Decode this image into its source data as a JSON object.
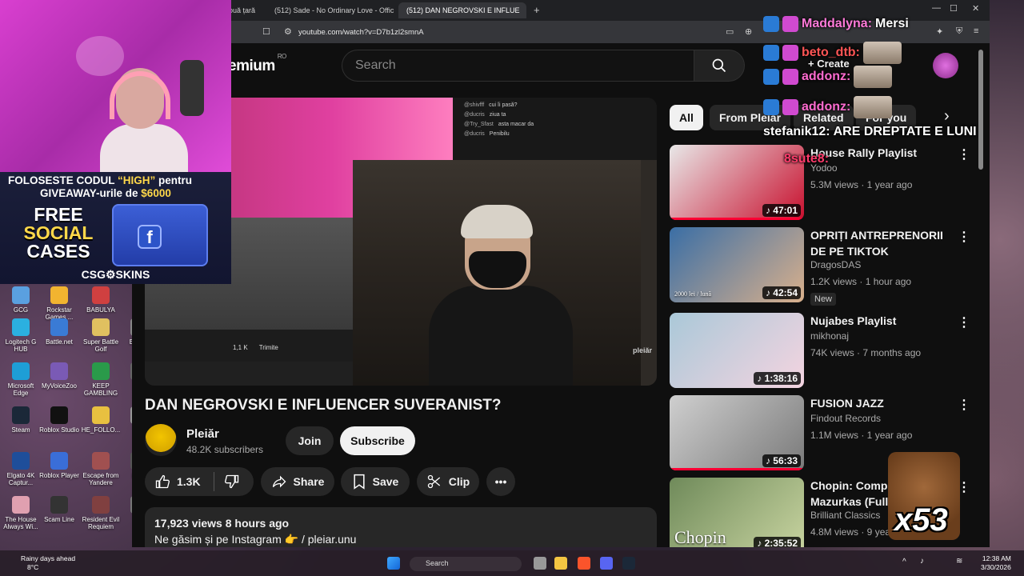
{
  "browser": {
    "tabs": [
      {
        "label": "ouă țară"
      },
      {
        "label": "(512) Sade - No Ordinary Love - Offic"
      },
      {
        "label": "(512) DAN NEGROVSKI E INFLUE"
      }
    ],
    "url": "youtube.com/watch?v=D7b1zl2smnA"
  },
  "youtube": {
    "logo_text": "emium",
    "logo_region": "RO",
    "search_placeholder": "Search",
    "create_label": "Create",
    "video_chat": [
      {
        "user": "@shivfff",
        "msg": "cui îi pasă?"
      },
      {
        "user": "@ducris",
        "msg": "ziua ta"
      },
      {
        "user": "@Try_Sfast",
        "msg": "asta macar da"
      },
      {
        "user": "@ducris",
        "msg": "Penibilu"
      }
    ],
    "video_likes_small": "1,1 K",
    "video_share_small": "Trimite",
    "video_watermark": "pleiăr",
    "video_title": "DAN NEGROVSKI E INFLUENCER SUVERANIST?",
    "channel_name": "Pleiăr",
    "channel_subs": "48.2K subscribers",
    "join_label": "Join",
    "subscribe_label": "Subscribe",
    "like_count": "1.3K",
    "share_label": "Share",
    "save_label": "Save",
    "clip_label": "Clip",
    "desc_meta": "17,923 views  8 hours ago",
    "desc_text": "Ne găsim și pe Instagram 👉  / pleiar.unu",
    "chips": [
      "All",
      "From Pleiăr",
      "Related",
      "For you"
    ],
    "recommendations": [
      {
        "title": "House Rally Playlist",
        "channel": "Yodoo",
        "meta": "5.3M views · 1 year ago",
        "duration": "47:01",
        "colors": [
          "#e8e8e8",
          "#c8102e"
        ]
      },
      {
        "title": "OPRIȚI ANTREPRENORII DE PE TIKTOK",
        "channel": "DragosDAS",
        "meta": "1.2K views · 1 hour ago",
        "duration": "42:54",
        "badge": "New",
        "thumb_text": "2000 lei / lună",
        "colors": [
          "#3a6ea5",
          "#d9b08c"
        ]
      },
      {
        "title": "Nujabes Playlist",
        "channel": "mikhonaj",
        "meta": "74K views · 7 months ago",
        "duration": "1:38:16",
        "colors": [
          "#aac8d8",
          "#f4d4e0"
        ]
      },
      {
        "title": "FUSION JAZZ",
        "channel": "Findout Records",
        "meta": "1.1M views · 1 year ago",
        "duration": "56:33",
        "colors": [
          "#cfcfcf",
          "#7a7a7a"
        ]
      },
      {
        "title": "Chopin: Complete Mazurkas (Full Album)",
        "channel": "Brilliant Classics",
        "meta": "4.8M views · 9 years ago",
        "duration": "2:35:52",
        "thumb_text": "Chopin",
        "colors": [
          "#6f8a5a",
          "#c8d4a0"
        ]
      }
    ]
  },
  "stream": {
    "promo_line1_a": "FOLOSESTE CODUL ",
    "promo_line1_code": "“HIGH”",
    "promo_line1_b": " pentru",
    "promo_line2_a": "GIVEAWAY-urile de ",
    "promo_line2_amount": "$6000",
    "promo_free": "FREE",
    "promo_social": "SOCIAL",
    "promo_cases": "CASES",
    "promo_brand": "CSG⚙SKINS",
    "chat": [
      {
        "user": "Maddalyna:",
        "msg": "Mersi",
        "color": "#ff7ad9"
      },
      {
        "user": "beto_dtb:",
        "msg": "",
        "color": "#ff5555"
      },
      {
        "user": "addonz:",
        "msg": "",
        "color": "#ff6bd0"
      },
      {
        "user": "addonz:",
        "msg": "",
        "color": "#ff6bd0"
      },
      {
        "user": "stefanik12:",
        "msg": "ARE DREPTATE E LUNI",
        "color": "#ffffff"
      },
      {
        "user": "8sute8:",
        "msg": "",
        "color": "#ff3b6b"
      }
    ],
    "emote_count": "x53"
  },
  "desktop": {
    "icons": [
      {
        "label": "GCG"
      },
      {
        "label": "Rockstar Games ..."
      },
      {
        "label": "BABULYA"
      },
      {
        "label": "Logitech G HUB"
      },
      {
        "label": "Battle.net"
      },
      {
        "label": "Super Battle Golf"
      },
      {
        "label": "Eve Cr"
      },
      {
        "label": "Microsoft Edge"
      },
      {
        "label": "MyVoiceZoo"
      },
      {
        "label": "KEEP GAMBLING"
      },
      {
        "label": "De"
      },
      {
        "label": "Steam"
      },
      {
        "label": "Roblox Studio"
      },
      {
        "label": "HE_FOLLO..."
      },
      {
        "label": "dim"
      },
      {
        "label": "Elgato 4K Captur..."
      },
      {
        "label": "Roblox Player"
      },
      {
        "label": "Escape from Yandere"
      },
      {
        "label": "F OT"
      },
      {
        "label": "The House Always Wi..."
      },
      {
        "label": "Scam Line"
      },
      {
        "label": "Resident Evil Requiem"
      },
      {
        "label": "PE"
      }
    ]
  },
  "taskbar": {
    "weather_line1": "Rainy days ahead",
    "weather_line2": "8°C",
    "search_label": "Search",
    "time": "12:38 AM",
    "date": "3/30/2026"
  }
}
